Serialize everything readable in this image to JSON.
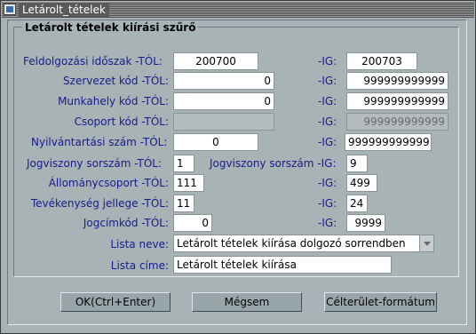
{
  "window": {
    "title": "Letárolt_tételek"
  },
  "group": {
    "title": "Letárolt tételek kiírási szűrő"
  },
  "rows": [
    {
      "label_from": "Feldolgozási időszak -TÓL:",
      "from": "200700",
      "label_to": "-IG:",
      "to": "200703"
    },
    {
      "label_from": "Szervezet kód -TÓL:",
      "from": "0",
      "label_to": "-IG:",
      "to": "999999999999"
    },
    {
      "label_from": "Munkahely kód -TÓL:",
      "from": "0",
      "label_to": "-IG:",
      "to": "999999999999"
    },
    {
      "label_from": "Csoport kód -TÓL:",
      "from": "",
      "label_to": "-IG:",
      "to": "999999999999"
    },
    {
      "label_from": "Nyilvántartási szám -TÓL:",
      "from": "0",
      "label_to": "-IG:",
      "to": "999999999999"
    },
    {
      "label_from": "Jogviszony sorszám -TÓL:",
      "from": "1",
      "label_to": "Jogviszony sorszám -IG:",
      "to": "9"
    },
    {
      "label_from": "Állománycsoport -TÓL:",
      "from": "111",
      "label_to": "-IG:",
      "to": "499"
    },
    {
      "label_from": "Tevékenység jellege -TÓL:",
      "from": "11",
      "label_to": "-IG:",
      "to": "24"
    },
    {
      "label_from": "Jogcímkód -TÓL:",
      "from": "0",
      "label_to": "-IG:",
      "to": "9999"
    }
  ],
  "list_name": {
    "label": "Lista neve:",
    "value": "Letárolt tételek kiírása dolgozó sorrendben"
  },
  "list_title": {
    "label": "Lista címe:",
    "value": "Letárolt tételek kiírása"
  },
  "buttons": {
    "ok": "OK(Ctrl+Enter)",
    "cancel": "Mégsem",
    "format": "Célterület-formátum"
  },
  "colors": {
    "window_bg": "#a8b3b6",
    "label": "#1a1a8c",
    "disabled_field": "#b4bcbf"
  }
}
